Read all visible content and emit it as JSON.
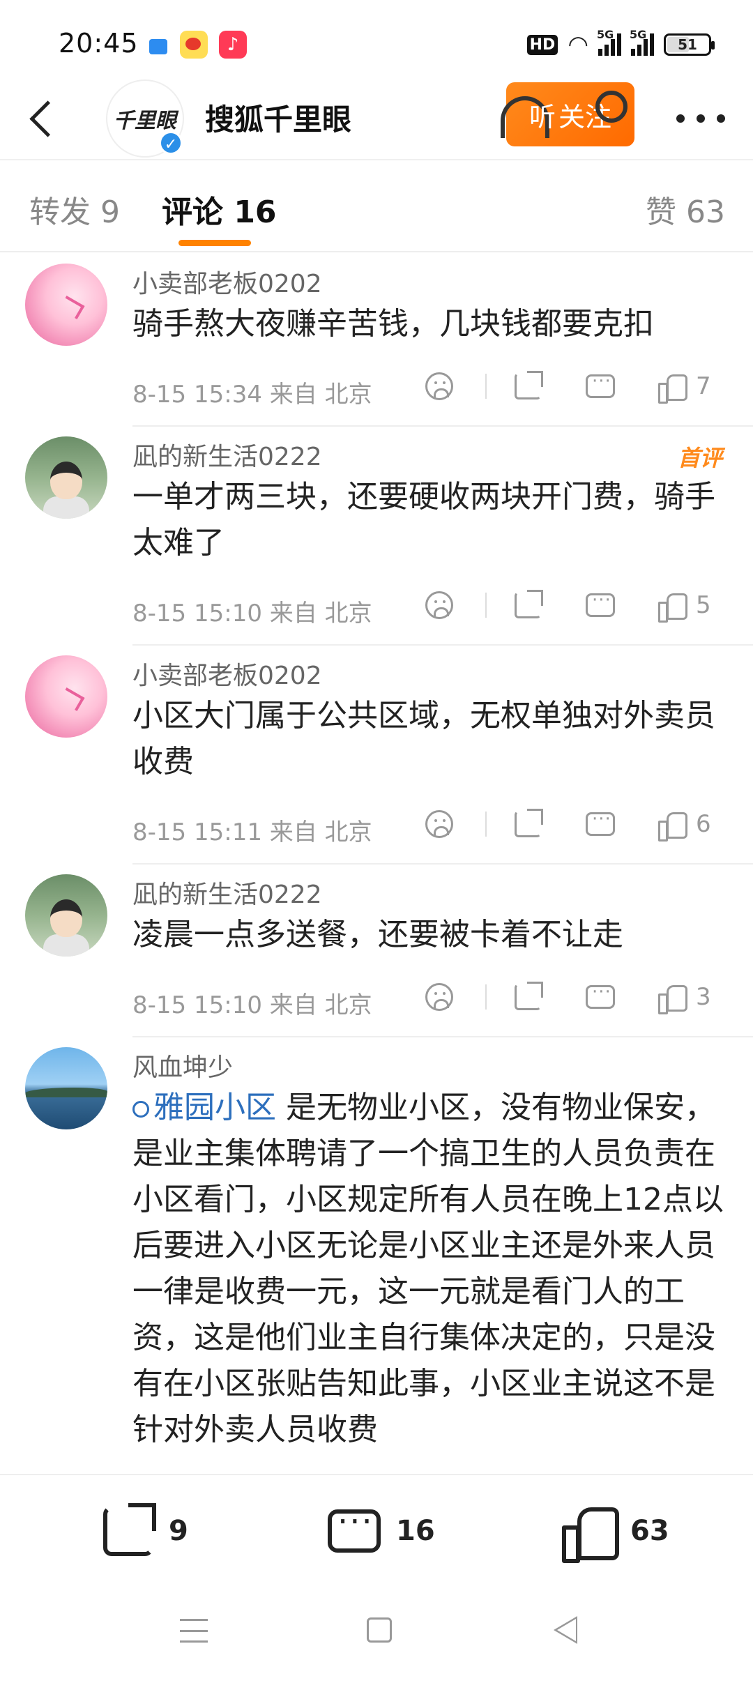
{
  "status_bar": {
    "time": "20:45",
    "network_badge": "HD",
    "signal_1": "5G",
    "signal_2": "5G",
    "battery": "51",
    "icons": [
      "blue-app-icon",
      "weibo-icon",
      "music-icon",
      "wifi-icon",
      "signal-icon",
      "battery-icon"
    ]
  },
  "header": {
    "back_icon": "chevron-left-icon",
    "account_logo": "千里眼",
    "account_name": "搜狐千里眼",
    "follow_label": "关注",
    "listen_label": "听",
    "more_icon": "more-dots-icon"
  },
  "tabs": {
    "repost": "转发 9",
    "comment": "评论 16",
    "like": "赞 63",
    "active": "comment",
    "accent": "#ff8200"
  },
  "comments": [
    {
      "user": "小卖部老板0202",
      "text": "骑手熬大夜赚辛苦钱，几块钱都要克扣",
      "time": "8-15 15:34 来自 北京",
      "likes": "7",
      "badge": ""
    },
    {
      "user": "凪的新生活0222",
      "text": "一单才两三块，还要硬收两块开门费，骑手太难了",
      "time": "8-15 15:10 来自 北京",
      "likes": "5",
      "badge": "首评"
    },
    {
      "user": "小卖部老板0202",
      "text": "小区大门属于公共区域，无权单独对外卖员收费",
      "time": "8-15 15:11 来自 北京",
      "likes": "6",
      "badge": ""
    },
    {
      "user": "凪的新生活0222",
      "text": "凌晨一点多送餐，还要被卡着不让走",
      "time": "8-15 15:10 来自 北京",
      "likes": "3",
      "badge": ""
    },
    {
      "user": "风血坤少",
      "topic": "雅园小区",
      "text": " 是无物业小区，没有物业保安，是业主集体聘请了一个搞卫生的人员负责在小区看门，小区规定所有人员在晚上12点以后要进入小区无论是小区业主还是外来人员一律是收费一元，这一元就是看门人的工资，这是他们业主自行集体决定的，只是没有在小区张贴告知此事，小区业主说这不是针对外卖人员收费",
      "time": "",
      "likes": "",
      "badge": ""
    }
  ],
  "bottom_bar": {
    "share_count": "9",
    "comment_count": "16",
    "like_count": "63"
  }
}
